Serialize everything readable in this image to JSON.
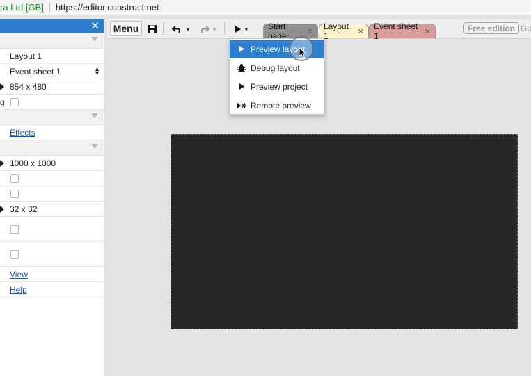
{
  "browser": {
    "org_label": "ra Ltd [GB]",
    "url": "https://editor.construct.net"
  },
  "properties_panel": {
    "rows": [
      {
        "type": "section"
      },
      {
        "type": "value",
        "value": "Layout 1"
      },
      {
        "type": "select",
        "value": "Event sheet 1"
      },
      {
        "type": "arrow-value",
        "value": "854 x 480"
      },
      {
        "type": "checkbox",
        "cut_label": "g"
      },
      {
        "type": "section"
      },
      {
        "type": "link",
        "value": "Effects"
      },
      {
        "type": "section"
      },
      {
        "type": "arrow-value",
        "value": "1000 x 1000"
      },
      {
        "type": "checkbox"
      },
      {
        "type": "checkbox"
      },
      {
        "type": "arrow-value",
        "value": "32 x 32"
      },
      {
        "type": "checkbox-tall"
      },
      {
        "type": "checkbox-tall"
      },
      {
        "type": "link",
        "value": "View"
      },
      {
        "type": "link",
        "value": "Help"
      }
    ]
  },
  "toolbar": {
    "menu_label": "Menu",
    "tabs": [
      {
        "label": "Start page"
      },
      {
        "label": "Layout 1"
      },
      {
        "label": "Event sheet 1"
      }
    ],
    "free_edition_label": "Free edition",
    "guest_label": "Gu"
  },
  "preview_menu": {
    "items": [
      {
        "label": "Preview layout",
        "icon": "play-icon",
        "active": true
      },
      {
        "label": "Debug layout",
        "icon": "bug-icon",
        "active": false
      },
      {
        "label": "Preview project",
        "icon": "play-icon",
        "active": false
      },
      {
        "label": "Remote preview",
        "icon": "remote-preview-icon",
        "active": false
      }
    ]
  },
  "colors": {
    "panel_header": "#2f7fd0",
    "menu_highlight": "#2f7fd0",
    "start_tab": "#8f8f8f",
    "layout_tab": "#fdf2c9",
    "event_tab": "#d89a9a",
    "canvas": "#272727"
  }
}
